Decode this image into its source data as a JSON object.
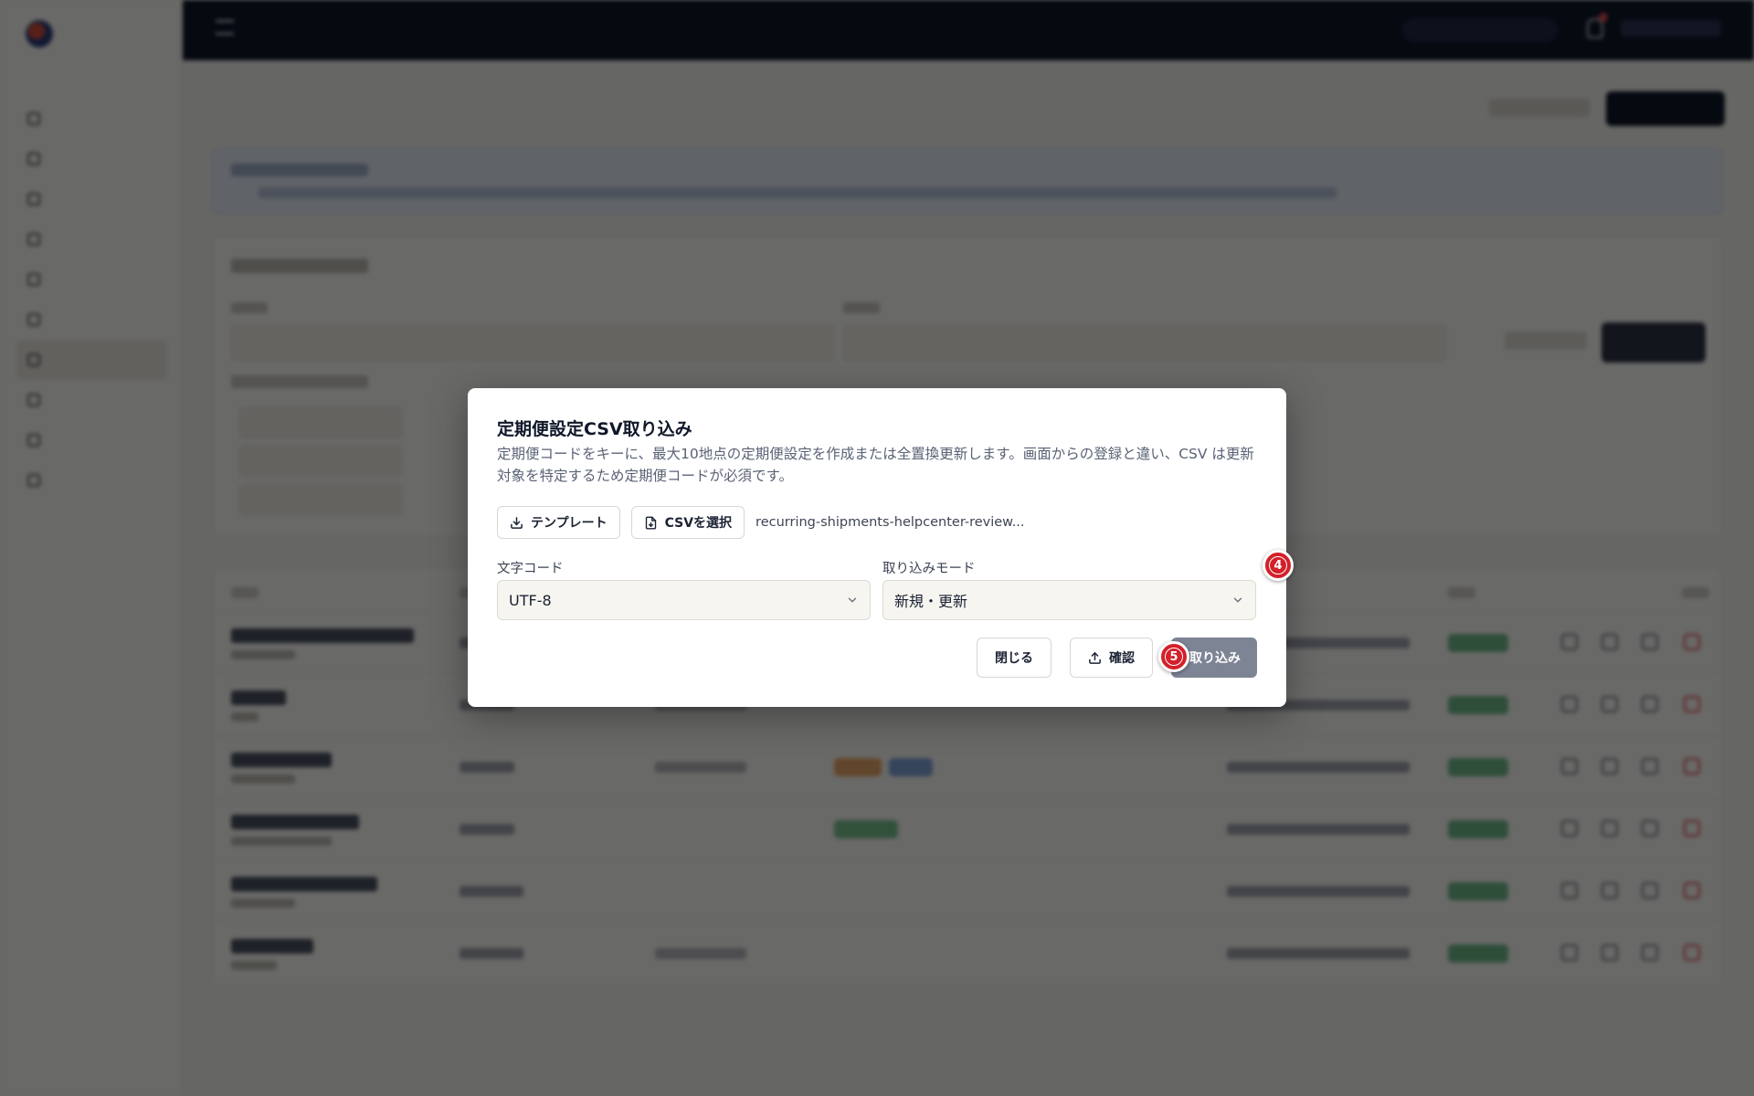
{
  "modal": {
    "title": "定期便設定CSV取り込み",
    "description": "定期便コードをキーに、最大10地点の定期便設定を作成または全置換更新します。画面からの登録と違い、CSV は更新対象を特定するため定期便コードが必須です。",
    "template_button": "テンプレート",
    "select_csv_button": "CSVを選択",
    "selected_file": "recurring-shipments-helpcenter-review...",
    "encoding": {
      "label": "文字コード",
      "value": "UTF-8"
    },
    "mode": {
      "label": "取り込みモード",
      "value": "新規・更新"
    },
    "close_button": "閉じる",
    "confirm_button": "確認",
    "import_button": "取り込み"
  },
  "markers": {
    "step4": "4",
    "step5": "5"
  },
  "icons": {
    "template": "download-icon",
    "select_csv": "file-icon",
    "confirm": "upload-icon",
    "select": "chevron-down-icon"
  },
  "colors": {
    "overlay": "#000000",
    "import_button_disabled": "#7d8494",
    "marker": "#d3202a",
    "topbar": "#0d1628"
  }
}
